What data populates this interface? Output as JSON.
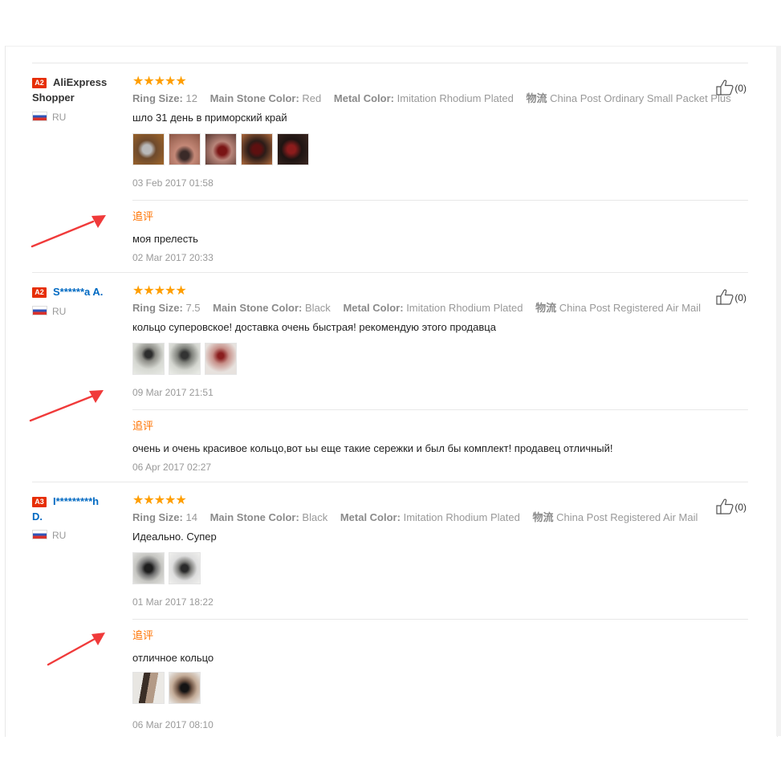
{
  "reviews": [
    {
      "level": "A2",
      "name": "AliExpress Shopper",
      "country": "RU",
      "stars": "★★★★★",
      "helpful": "(0)",
      "attributes": [
        {
          "label": "Ring Size:",
          "value": "12"
        },
        {
          "label": "Main Stone Color:",
          "value": "Red"
        },
        {
          "label": "Metal Color:",
          "value": "Imitation Rhodium Plated"
        },
        {
          "label": "物流",
          "value": "China Post Ordinary Small Packet Plus"
        }
      ],
      "text": "шло 31 день в приморский край",
      "photos": 5,
      "date": "03 Feb 2017 01:58",
      "append_label": "追评",
      "append_text": "моя прелесть",
      "append_date": "02 Mar 2017 20:33"
    },
    {
      "level": "A2",
      "name": "S******a A.",
      "country": "RU",
      "stars": "★★★★★",
      "helpful": "(0)",
      "attributes": [
        {
          "label": "Ring Size:",
          "value": "7.5"
        },
        {
          "label": "Main Stone Color:",
          "value": "Black"
        },
        {
          "label": "Metal Color:",
          "value": "Imitation Rhodium Plated"
        },
        {
          "label": "物流",
          "value": "China Post Registered Air Mail"
        }
      ],
      "text": "кольцо суперовское! доставка очень быстрая! рекомендую этого продавца",
      "photos": 3,
      "date": "09 Mar 2017 21:51",
      "append_label": "追评",
      "append_text": "очень и очень красивое кольцо,вот ьы еще такие сережки и был бы комплект! продавец отличный!",
      "append_date": "06 Apr 2017 02:27"
    },
    {
      "level": "A3",
      "name_line1": "I*********h",
      "name_line2": "D.",
      "country": "RU",
      "stars": "★★★★★",
      "helpful": "(0)",
      "attributes": [
        {
          "label": "Ring Size:",
          "value": "14"
        },
        {
          "label": "Main Stone Color:",
          "value": "Black"
        },
        {
          "label": "Metal Color:",
          "value": "Imitation Rhodium Plated"
        },
        {
          "label": "物流",
          "value": "China Post Registered Air Mail"
        }
      ],
      "text": "Идеально. Супер",
      "photos": 2,
      "date": "01 Mar 2017 18:22",
      "append_label": "追评",
      "append_text": "отличное кольцо",
      "append_photos": 2,
      "append_date": "06 Mar 2017 08:10"
    }
  ],
  "colors": {
    "star": "#ff9e00",
    "append": "#ff7300",
    "level_badge": "#e62e04",
    "link": "#0069c2",
    "arrow": "#f03a3a"
  }
}
